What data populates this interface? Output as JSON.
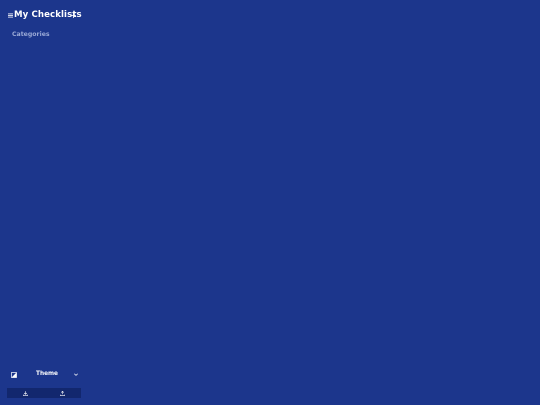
{
  "header": {
    "title": "My Checklists",
    "menu_icon": "menu-icon",
    "add_icon": "plus-icon"
  },
  "sidebar": {
    "section_label": "Categories"
  },
  "footer": {
    "theme_label": "Theme",
    "theme_icon": "theme-toggle-icon",
    "import_icon": "download-icon",
    "export_icon": "upload-icon"
  },
  "colors": {
    "background": "#1c368c",
    "bottom_bar": "#12276e",
    "muted_text": "#9aa9d6",
    "text": "#ffffff"
  }
}
